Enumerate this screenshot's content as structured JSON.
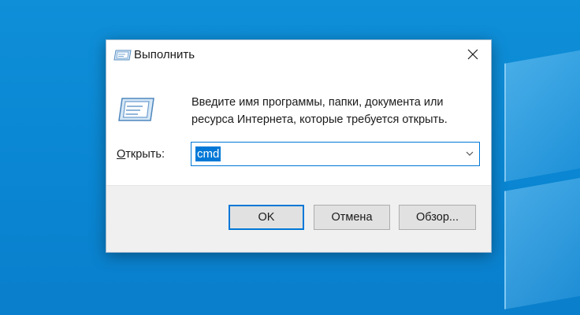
{
  "dialog": {
    "title": "Выполнить",
    "description": "Введите имя программы, папки, документа или ресурса Интернета, которые требуется открыть.",
    "open_label_prefix": "О",
    "open_label_rest": "ткрыть:",
    "input_value": "cmd",
    "buttons": {
      "ok": "OK",
      "cancel": "Отмена",
      "browse": "Обзор..."
    }
  },
  "icons": {
    "title_icon": "run-icon",
    "main_icon": "run-icon",
    "close_icon": "close-icon",
    "dropdown_icon": "chevron-down-icon"
  },
  "colors": {
    "accent": "#0078d7",
    "desktop": "#0a86d2"
  }
}
